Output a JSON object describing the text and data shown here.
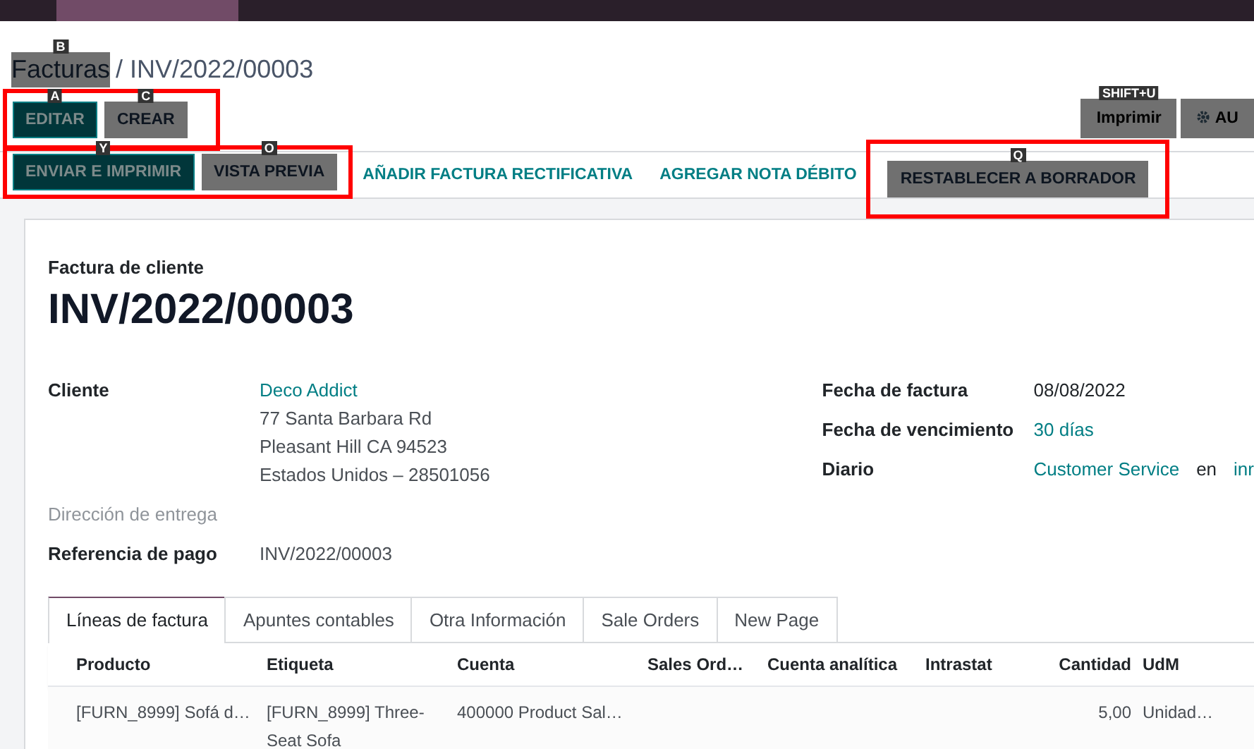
{
  "breadcrumb": {
    "parent": "Facturas",
    "parent_hotkey": "B",
    "current": "/ INV/2022/00003"
  },
  "control_group": {
    "highlighted": true,
    "buttons": [
      {
        "label": "EDITAR",
        "kind": "primary",
        "hotkey": "A"
      },
      {
        "label": "CREAR",
        "kind": "secondary",
        "hotkey": "C"
      }
    ]
  },
  "right_buttons": [
    {
      "label": "Imprimir",
      "kind": "print",
      "hotkey": "SHIFT+U"
    },
    {
      "label": "AU",
      "kind": "action"
    }
  ],
  "status_groups": [
    {
      "highlighted": true,
      "buttons": [
        {
          "label": "ENVIAR E IMPRIMIR",
          "kind": "primary",
          "hotkey": "Y"
        },
        {
          "label": "VISTA PREVIA",
          "kind": "secondary",
          "hotkey": "O"
        }
      ]
    },
    {
      "highlighted": false,
      "buttons": [
        {
          "label": "AÑADIR FACTURA RECTIFICATIVA",
          "kind": "link"
        },
        {
          "label": "AGREGAR NOTA DÉBITO",
          "kind": "link"
        }
      ]
    },
    {
      "highlighted": true,
      "buttons": [
        {
          "label": "RESTABLECER A BORRADOR",
          "kind": "secondary",
          "hotkey": "Q"
        }
      ]
    }
  ],
  "form": {
    "subtitle": "Factura de cliente",
    "title": "INV/2022/00003",
    "left_fields": [
      {
        "label": "Cliente",
        "muted": false,
        "values": [
          {
            "text": "Deco Addict",
            "link": true
          },
          {
            "text": "77 Santa Barbara Rd",
            "link": false
          },
          {
            "text": "Pleasant Hill CA 94523",
            "link": false
          },
          {
            "text": "Estados Unidos – 28501056",
            "link": false
          }
        ]
      },
      {
        "label": "Dirección de entrega",
        "muted": true
      },
      {
        "label": "Referencia de pago",
        "muted": false,
        "values": [
          {
            "text": "INV/2022/00003",
            "link": false
          }
        ]
      }
    ],
    "right_fields": [
      {
        "label": "Fecha de factura",
        "parts": [
          {
            "text": "08/08/2022",
            "link": false
          }
        ]
      },
      {
        "label": "Fecha de vencimiento",
        "parts": [
          {
            "text": "30 días",
            "link": true
          }
        ]
      },
      {
        "label": "Diario",
        "parts": [
          {
            "text": "Customer Service",
            "link": true
          },
          {
            "text": "en",
            "link": false
          },
          {
            "text": "inr",
            "link": true
          }
        ]
      }
    ]
  },
  "tabs": [
    {
      "label": "Líneas de factura",
      "selected": true
    },
    {
      "label": "Apuntes contables",
      "selected": false
    },
    {
      "label": "Otra Información",
      "selected": false
    },
    {
      "label": "Sale Orders",
      "selected": false
    },
    {
      "label": "New Page",
      "selected": false
    }
  ],
  "table": {
    "columns": [
      {
        "label": "Producto",
        "kind": "text"
      },
      {
        "label": "Etiqueta",
        "kind": "text"
      },
      {
        "label": "Cuenta",
        "kind": "text"
      },
      {
        "label": "Sales Ord…",
        "kind": "text"
      },
      {
        "label": "Cuenta analítica",
        "kind": "text"
      },
      {
        "label": "Intrastat",
        "kind": "text"
      },
      {
        "label": "Cantidad",
        "kind": "number"
      },
      {
        "label": "UdM",
        "kind": "text"
      }
    ],
    "rows": [
      [
        "[FURN_8999] Sofá d…",
        "[FURN_8999] Three-Seat Sofa",
        "400000 Product Sal…",
        "",
        "",
        "",
        "5,00",
        "Unidad…"
      ]
    ]
  }
}
